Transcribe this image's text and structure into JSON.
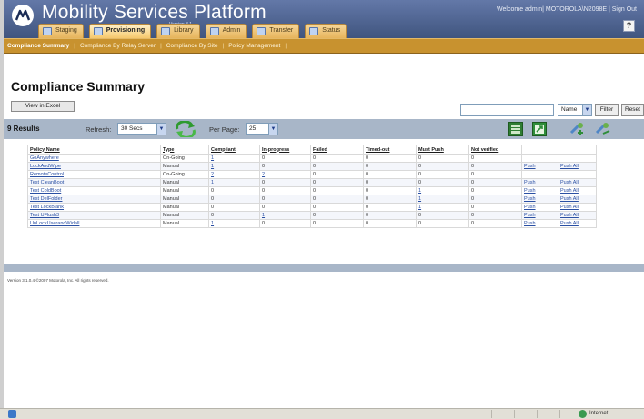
{
  "header": {
    "title": "Mobility Services Platform",
    "version": "Version 3.1",
    "welcome": "Welcome admin| MOTOROLA\\N2098E | Sign Out",
    "help_label": "?"
  },
  "tabs": [
    {
      "label": "Staging",
      "active": false
    },
    {
      "label": "Provisioning",
      "active": true
    },
    {
      "label": "Library",
      "active": false
    },
    {
      "label": "Admin",
      "active": false
    },
    {
      "label": "Transfer",
      "active": false
    },
    {
      "label": "Status",
      "active": false
    }
  ],
  "subnav": [
    "Compliance Summary",
    "Compliance By Relay Server",
    "Compliance By Site",
    "Policy Management"
  ],
  "page": {
    "title": "Compliance Summary",
    "excel_button": "View in Excel",
    "filter_select": "Name",
    "filter_button": "Filter",
    "reset_button": "Reset"
  },
  "toolbar": {
    "results": "9 Results",
    "refresh_label": "Refresh:",
    "refresh_value": "30 Secs",
    "perpage_label": "Per Page:",
    "perpage_value": "25"
  },
  "table": {
    "headers": [
      "Policy Name",
      "Type",
      "Compliant",
      "In-progress",
      "Failed",
      "Timed-out",
      "Must Push",
      "Not verified"
    ],
    "rows": [
      {
        "name": "GoAnywhere",
        "type": "On-Going",
        "compliant": "1",
        "inprogress": "0",
        "failed": "0",
        "timedout": "0",
        "mustpush": "0",
        "notverified": "0",
        "push": "",
        "pushall": ""
      },
      {
        "name": "LockAndWipe",
        "type": "Manual",
        "compliant": "1",
        "inprogress": "0",
        "failed": "0",
        "timedout": "0",
        "mustpush": "0",
        "notverified": "0",
        "push": "Push",
        "pushall": "Push All"
      },
      {
        "name": "RemoteControl",
        "type": "On-Going",
        "compliant": "2",
        "inprogress": "2",
        "failed": "0",
        "timedout": "0",
        "mustpush": "0",
        "notverified": "0",
        "push": "",
        "pushall": ""
      },
      {
        "name": "Test CleanBoot",
        "type": "Manual",
        "compliant": "1",
        "inprogress": "0",
        "failed": "0",
        "timedout": "0",
        "mustpush": "0",
        "notverified": "0",
        "push": "Push",
        "pushall": "Push All"
      },
      {
        "name": "Test ColdBoot",
        "type": "Manual",
        "compliant": "0",
        "inprogress": "0",
        "failed": "0",
        "timedout": "0",
        "mustpush": "1",
        "notverified": "0",
        "push": "Push",
        "pushall": "Push All"
      },
      {
        "name": "Test DelFolder",
        "type": "Manual",
        "compliant": "0",
        "inprogress": "0",
        "failed": "0",
        "timedout": "0",
        "mustpush": "1",
        "notverified": "0",
        "push": "Push",
        "pushall": "Push All"
      },
      {
        "name": "Test LockBlank",
        "type": "Manual",
        "compliant": "0",
        "inprogress": "0",
        "failed": "0",
        "timedout": "0",
        "mustpush": "1",
        "notverified": "0",
        "push": "Push",
        "pushall": "Push All"
      },
      {
        "name": "Test UFlush3",
        "type": "Manual",
        "compliant": "0",
        "inprogress": "1",
        "failed": "0",
        "timedout": "0",
        "mustpush": "0",
        "notverified": "0",
        "push": "Push",
        "pushall": "Push All"
      },
      {
        "name": "UnLockUserandWidall",
        "type": "Manual",
        "compliant": "1",
        "inprogress": "0",
        "failed": "0",
        "timedout": "0",
        "mustpush": "0",
        "notverified": "0",
        "push": "Push",
        "pushall": "Push All"
      }
    ]
  },
  "footer": {
    "version": "Version 3.1.0.4-©2007 Motorola, Inc. All rights reserved."
  },
  "statusbar": {
    "zone": "Internet"
  },
  "colors": {
    "header": "#4a5f8e",
    "tab": "#f2c77a",
    "subnav": "#c8922f",
    "toolbar": "#a8b6c8",
    "link": "#2a4fa3"
  },
  "icons": [
    "motorola-logo-icon",
    "refresh-icon",
    "grid-view-icon",
    "export-icon",
    "add-policy-icon",
    "edit-policy-icon",
    "ie-page-icon",
    "globe-icon"
  ]
}
